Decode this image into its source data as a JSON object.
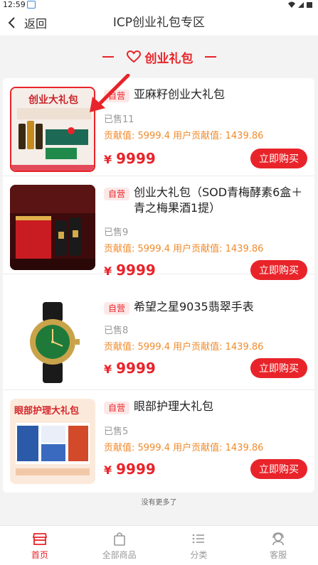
{
  "status_bar": {
    "time": "12:59"
  },
  "header": {
    "back_label": "返回",
    "title": "ICP创业礼包专区"
  },
  "section": {
    "title": "创业礼包"
  },
  "products": [
    {
      "tag": "自营",
      "name": "亚麻籽创业大礼包",
      "sold": "已售11",
      "contribution": "贡献值: 5999.4   用户贡献值: 1439.86",
      "currency": "¥",
      "price": "9999",
      "buy_label": "立即购买",
      "image_text": "创业大礼包"
    },
    {
      "tag": "自营",
      "name": "创业大礼包（SOD青梅酵素6盒＋青之梅果酒1提）",
      "sold": "已售9",
      "contribution": "贡献值: 5999.4   用户贡献值: 1439.86",
      "currency": "¥",
      "price": "9999",
      "buy_label": "立即购买"
    },
    {
      "tag": "自营",
      "name": "希望之星9035翡翠手表",
      "sold": "已售8",
      "contribution": "贡献值: 5999.4   用户贡献值: 1439.86",
      "currency": "¥",
      "price": "9999",
      "buy_label": "立即购买"
    },
    {
      "tag": "自营",
      "name": "眼部护理大礼包",
      "sold": "已售5",
      "contribution": "贡献值: 5999.4   用户贡献值: 1439.86",
      "currency": "¥",
      "price": "9999",
      "buy_label": "立即购买",
      "image_text": "眼部护理大礼包"
    }
  ],
  "footer_note": "没有更多了",
  "tabbar": [
    {
      "label": "首页",
      "icon": "store-icon",
      "active": true
    },
    {
      "label": "全部商品",
      "icon": "shopping-bag-icon",
      "active": false
    },
    {
      "label": "分类",
      "icon": "list-icon",
      "active": false
    },
    {
      "label": "客服",
      "icon": "headset-icon",
      "active": false
    }
  ],
  "colors": {
    "accent": "#e8242a",
    "contribution": "#f08a2a",
    "tag_bg": "#fde8e8"
  }
}
